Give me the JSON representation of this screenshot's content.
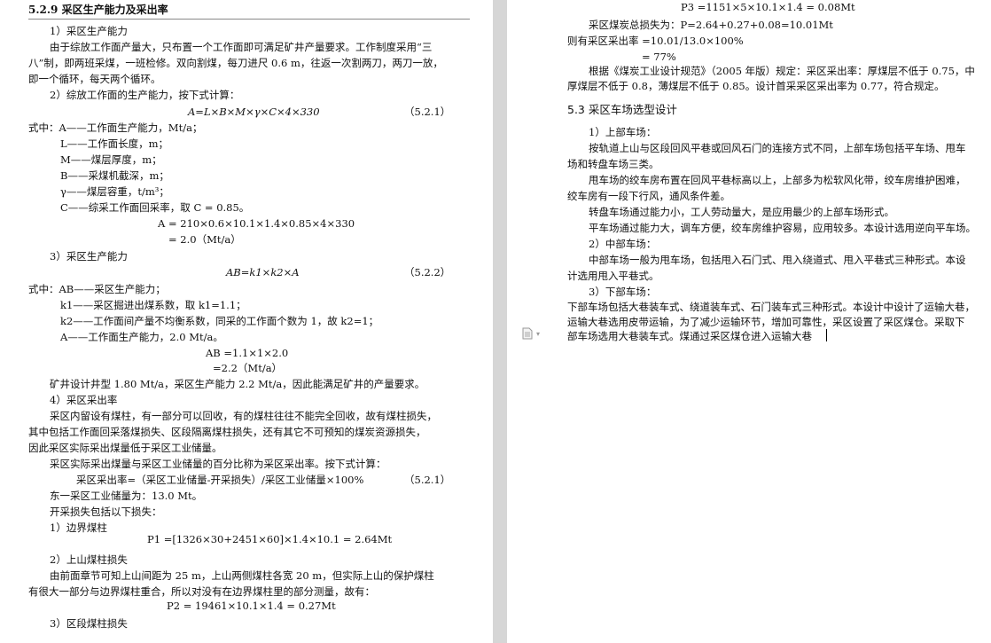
{
  "left": {
    "section_title": "5.2.9 采区生产能力及采出率",
    "s1_title": "1）采区生产能力",
    "s1_p1": "由于综放工作面产量大，只布置一个工作面即可满足矿井产量要求。工作制度采用“三",
    "s1_p2": "八”制，即两班采煤，一班检修。双向割煤，每刀进尺 0.6 m，往返一次割两刀，两刀一放，",
    "s1_p3": "即一个循环，每天两个循环。",
    "s2_title": "2）综放工作面的生产能力，按下式计算：",
    "eq1": "A=L×B×M×γ×C×4×330",
    "eq1_no": "（5.2.1）",
    "where1": "式中：A——工作面生产能力，Mt/a；",
    "def_L": "L——工作面长度，m；",
    "def_M": "M——煤层厚度，m；",
    "def_B": "B——采煤机截深，m；",
    "def_gamma": "γ——煤层容重，t/m³；",
    "def_C": "C——综采工作面回采率，取 C = 0.85。",
    "calc1": "A = 210×0.6×10.1×1.4×0.85×4×330",
    "calc1_res": "= 2.0（Mt/a）",
    "s3_title": "3）采区生产能力",
    "eq2": "AB=k1×k2×A",
    "eq2_no": "（5.2.2）",
    "where2": "式中：AB——采区生产能力；",
    "def_k1": "k1——采区掘进出煤系数，取 k1=1.1；",
    "def_k2": "k2——工作面间产量不均衡系数，同采的工作面个数为 1，故 k2=1；",
    "def_A": "A——工作面生产能力，2.0 Mt/a。",
    "calc2": "AB =1.1×1×2.0",
    "calc2_res": "=2.2（Mt/a）",
    "concl": "矿井设计井型 1.80 Mt/a，采区生产能力 2.2 Mt/a，因此能满足矿井的产量要求。",
    "s4_title": "4）采区采出率",
    "s4_p1": "采区内留设有煤柱，有一部分可以回收，有的煤柱往往不能完全回收，故有煤柱损失，",
    "s4_p2": "其中包括工作面回采落煤损失、区段隔离煤柱损失，还有其它不可预知的煤炭资源损失，",
    "s4_p3": "因此采区实际采出煤量低于采区工业储量。",
    "s4_p4": "采区实际采出煤量与采区工业储量的百分比称为采区采出率。按下式计算：",
    "eq3": "采区采出率=（采区工业储量-开采损失）/采区工业储量×100%",
    "eq3_no": "（5.2.1）",
    "reserve": "东一采区工业储量为：13.0 Mt。",
    "loss_intro": "开采损失包括以下损失：",
    "loss1_title": "1）边界煤柱",
    "loss1_eq": "P1 =[1326×30+2451×60]×1.4×10.1 = 2.64Mt",
    "loss2_title": "2）上山煤柱损失",
    "loss2_p1": "由前面章节可知上山间距为 25 m，上山两侧煤柱各宽 20 m，但实际上山的保护煤柱",
    "loss2_p2": "有很大一部分与边界煤柱重合，所以对没有在边界煤柱里的部分测量，故有：",
    "loss2_eq": "P2 = 19461×10.1×1.4 = 0.27Mt",
    "loss3_title": "3）区段煤柱损失"
  },
  "right": {
    "eq_p3": "P3 =1151×5×10.1×1.4 = 0.08Mt",
    "total_loss": "采区煤炭总损失为：P=2.64+0.27+0.08=10.01Mt",
    "rate1": "则有采区采出率 =10.01/13.0×100%",
    "rate2": "= 77%",
    "regul_p1": "根据《煤炭工业设计规范》（2005 年版）规定：采区采出率：厚煤层不低于 0.75，中",
    "regul_p2": "厚煤层不低于 0.8，薄煤层不低于 0.85。设计首采采区采出率为 0.77，符合规定。",
    "section2_title": "5.3 采区车场选型设计",
    "top_title": "1）上部车场：",
    "top_p1": "按轨道上山与区段回风平巷或回风石门的连接方式不同，上部车场包括平车场、甩车",
    "top_p2": "场和转盘车场三类。",
    "top_p3": "甩车场的绞车房布置在回风平巷标高以上，上部多为松软风化带，绞车房维护困难，",
    "top_p4": "绞车房有一段下行风，通风条件差。",
    "top_p5": "转盘车场通过能力小，工人劳动量大，是应用最少的上部车场形式。",
    "top_p6": "平车场通过能力大，调车方便，绞车房维护容易，应用较多。本设计选用逆向平车场。",
    "mid_title": "2）中部车场：",
    "mid_p1": "中部车场一般为甩车场，包括甩入石门式、甩入绕道式、甩入平巷式三种形式。本设",
    "mid_p2": "计选用甩入平巷式。",
    "bot_title": "3）下部车场：",
    "bot_p1": "下部车场包括大巷装车式、绕道装车式、石门装车式三种形式。本设计中设计了运输大巷，",
    "bot_p2": "运输大巷选用皮带运输，为了减少运输环节，增加可靠性，采区设置了采区煤仓。采取下",
    "bot_p3": "部车场选用大巷装车式。煤通过采区煤仓进入运输大巷"
  },
  "icons": {
    "doc": "document-icon",
    "caret": "chevron-down-icon"
  },
  "colors": {
    "gutter": "#d6d6d6",
    "page": "#ffffff",
    "text": "#111111"
  }
}
